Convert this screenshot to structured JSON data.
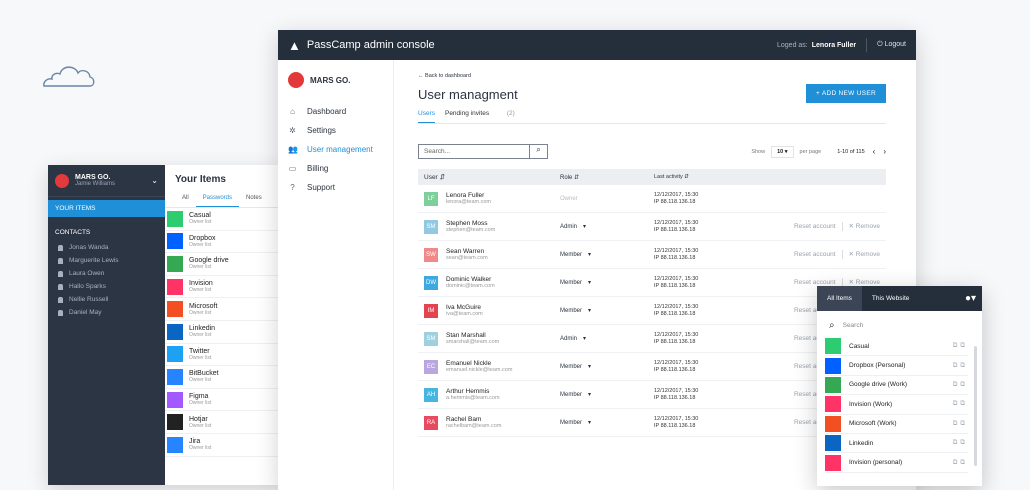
{
  "left_app": {
    "org": "MARS GO.",
    "user": "Jamie Williams",
    "selected": "YOUR ITEMS",
    "contacts_heading": "CONTACTS",
    "contacts": [
      "Jonas Wanda",
      "Marguerite Lewis",
      "Laura Owen",
      "Hallo Sparks",
      "Nellie Russell",
      "Daniel May"
    ],
    "title": "Your Items",
    "tabs": [
      "All",
      "Passwords",
      "Notes"
    ],
    "items": [
      {
        "name": "Casual",
        "owner": "Owner list",
        "icon": "casual-icon",
        "color": "#2ecc71"
      },
      {
        "name": "Dropbox",
        "owner": "Owner list",
        "icon": "dropbox-icon",
        "color": "#0061fe"
      },
      {
        "name": "Google drive",
        "owner": "Owner list",
        "icon": "google-drive-icon",
        "color": "#34a853"
      },
      {
        "name": "Invision",
        "owner": "Owner list",
        "icon": "invision-icon",
        "color": "#ff3366"
      },
      {
        "name": "Microsoft",
        "owner": "Owner list",
        "icon": "microsoft-icon",
        "color": "#f25022"
      },
      {
        "name": "Linkedin",
        "owner": "Owner list",
        "icon": "linkedin-icon",
        "color": "#0a66c2"
      },
      {
        "name": "Twitter",
        "owner": "Owner list",
        "icon": "twitter-icon",
        "color": "#1da1f2"
      },
      {
        "name": "BitBucket",
        "owner": "Owner list",
        "icon": "bitbucket-icon",
        "color": "#2684ff"
      },
      {
        "name": "Figma",
        "owner": "Owner list",
        "icon": "figma-icon",
        "color": "#a259ff"
      },
      {
        "name": "Hotjar",
        "owner": "Owner list",
        "icon": "hotjar-icon",
        "color": "#222222"
      },
      {
        "name": "Jira",
        "owner": "Owner list",
        "icon": "jira-icon",
        "color": "#2684ff"
      }
    ]
  },
  "console": {
    "title": "PassCamp admin console",
    "logged_label": "Loged as:",
    "logged_name": "Lenora Fuller",
    "logout": "Logout",
    "org": "MARS GO.",
    "nav": [
      {
        "label": "Dashboard",
        "icon": "home-icon",
        "glyph": "⌂"
      },
      {
        "label": "Settings",
        "icon": "gear-icon",
        "glyph": "✲"
      },
      {
        "label": "User management",
        "icon": "users-icon",
        "glyph": "👥",
        "active": true
      },
      {
        "label": "Billing",
        "icon": "card-icon",
        "glyph": "▭"
      },
      {
        "label": "Support",
        "icon": "help-icon",
        "glyph": "?"
      }
    ],
    "back": "← Back to dashboard",
    "page_title": "User managment",
    "add_button": "+ ADD NEW USER",
    "tab_users": "Users",
    "tab_pending": "Pending invites",
    "tab_pending_count": "(2)",
    "search_placeholder": "Search...",
    "show_label": "Show",
    "per_page_value": "10",
    "per_page_label": "per page",
    "pagination": "1-10 of 115",
    "headers": {
      "user": "User ⇵",
      "role": "Role ⇵",
      "activity": "Last activity ⇵"
    },
    "reset_label": "Reset account",
    "remove_label": "✕ Remove",
    "rows": [
      {
        "initials": "LF",
        "color": "#7fcf9a",
        "name": "Lenora Fuller",
        "email": "lenora@team.com",
        "role": "Owner",
        "date": "12/12/2017, 15:30",
        "ip": "IP 88.118.136.18"
      },
      {
        "initials": "SM",
        "color": "#93c9e0",
        "name": "Stephen Moss",
        "email": "stephen@team.com",
        "role": "Admin",
        "date": "12/12/2017, 15:30",
        "ip": "IP 88.118.136.18"
      },
      {
        "initials": "SW",
        "color": "#f08a8a",
        "name": "Sean Warren",
        "email": "sean@team.com",
        "role": "Member",
        "date": "12/12/2017, 15:30",
        "ip": "IP 88.118.136.18"
      },
      {
        "initials": "DW",
        "color": "#3fa9df",
        "name": "Dominic Walker",
        "email": "dominic@team.com",
        "role": "Member",
        "date": "12/12/2017, 15:30",
        "ip": "IP 88.118.136.18"
      },
      {
        "initials": "IM",
        "color": "#e2454f",
        "name": "Iva McGuire",
        "email": "iva@team.com",
        "role": "Member",
        "date": "12/12/2017, 15:30",
        "ip": "IP 88.118.136.18"
      },
      {
        "initials": "SM",
        "color": "#9fd0e0",
        "name": "Stan Marshall",
        "email": "smarshall@team.com",
        "role": "Admin",
        "date": "12/12/2017, 15:30",
        "ip": "IP 88.118.136.18"
      },
      {
        "initials": "EC",
        "color": "#b9a6df",
        "name": "Emanuel Nickle",
        "email": "emanuel.nickle@team.com",
        "role": "Member",
        "date": "12/12/2017, 15:30",
        "ip": "IP 88.118.136.18"
      },
      {
        "initials": "AH",
        "color": "#46b6e0",
        "name": "Arthur Hemmis",
        "email": "a.hemmis@team.com",
        "role": "Member",
        "date": "12/12/2017, 15:30",
        "ip": "IP 88.118.136.18"
      },
      {
        "initials": "RA",
        "color": "#e84a5f",
        "name": "Rachel Bam",
        "email": "rachelbam@team.com",
        "role": "Member",
        "date": "12/12/2017, 15:30",
        "ip": "IP 88.118.136.18"
      }
    ]
  },
  "extension": {
    "tab_all": "All Items",
    "tab_site": "This Website",
    "search_placeholder": "Search",
    "items": [
      {
        "name": "Casual",
        "icon": "casual-icon",
        "color": "#2ecc71"
      },
      {
        "name": "Dropbox (Personal)",
        "icon": "dropbox-icon",
        "color": "#0061fe"
      },
      {
        "name": "Google drive (Work)",
        "icon": "google-drive-icon",
        "color": "#34a853"
      },
      {
        "name": "Invision (Work)",
        "icon": "invision-icon",
        "color": "#ff3366"
      },
      {
        "name": "Microsoft (Work)",
        "icon": "microsoft-icon",
        "color": "#f25022"
      },
      {
        "name": "Linkedin",
        "icon": "linkedin-icon",
        "color": "#0a66c2"
      },
      {
        "name": "Invision (personal)",
        "icon": "invision-icon",
        "color": "#ff3366"
      }
    ]
  }
}
